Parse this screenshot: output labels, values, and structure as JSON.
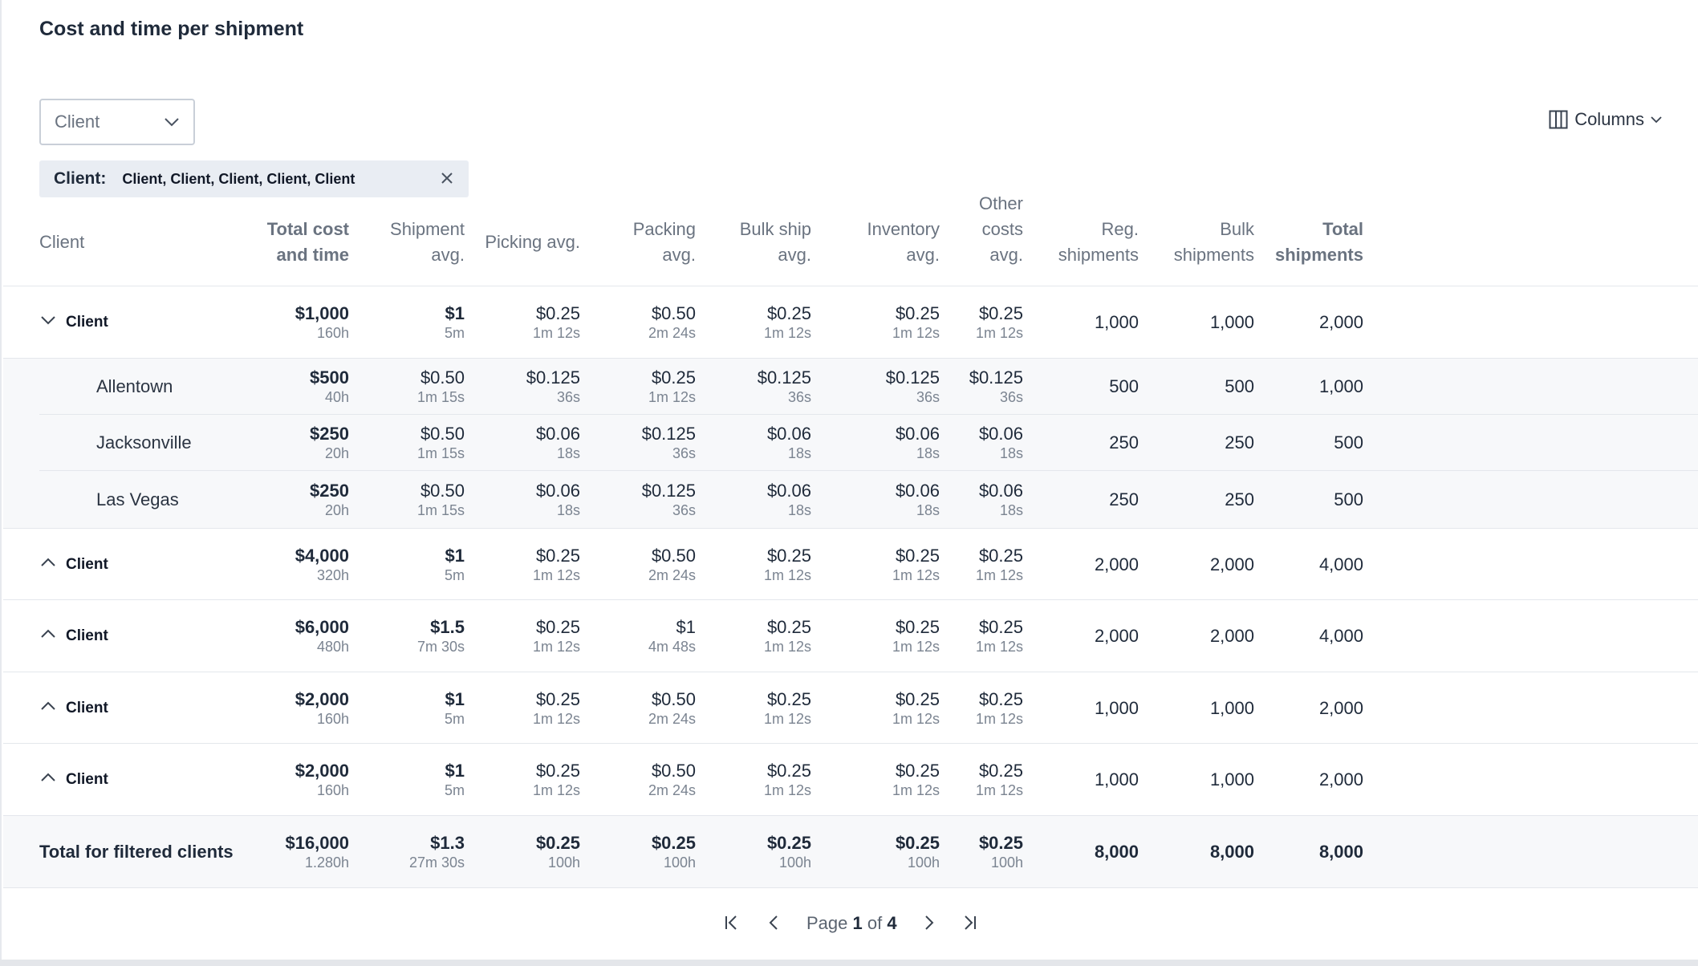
{
  "title": "Cost and time per shipment",
  "filter": {
    "select_value": "Client",
    "chip_label": "Client:",
    "chip_value": "Client, Client, Client, Client, Client"
  },
  "toolbar": {
    "columns_label": "Columns"
  },
  "icons": {
    "chevron": "chevron-down-icon",
    "columns": "columns-icon",
    "close": "close-icon"
  },
  "columns": [
    {
      "key": "client",
      "label": [
        "Client"
      ]
    },
    {
      "key": "total",
      "label": [
        "Total cost",
        "and time"
      ]
    },
    {
      "key": "ship",
      "label": [
        "Shipment",
        "avg."
      ]
    },
    {
      "key": "pick",
      "label": [
        "Picking avg."
      ]
    },
    {
      "key": "pack",
      "label": [
        "Packing",
        "avg."
      ]
    },
    {
      "key": "bulk",
      "label": [
        "Bulk ship",
        "avg."
      ]
    },
    {
      "key": "inv",
      "label": [
        "Inventory",
        "avg."
      ]
    },
    {
      "key": "other",
      "label": [
        "Other",
        "costs",
        "avg."
      ]
    },
    {
      "key": "reg",
      "label": [
        "Reg.",
        "shipments"
      ]
    },
    {
      "key": "bship",
      "label": [
        "Bulk",
        "shipments"
      ]
    },
    {
      "key": "tship",
      "label": [
        "Total",
        "shipments"
      ]
    }
  ],
  "rows": [
    {
      "type": "parent",
      "expanded": true,
      "name": "Client",
      "cells": [
        [
          "$1,000",
          "160h"
        ],
        [
          "$1",
          "5m"
        ],
        [
          "$0.25",
          "1m 12s"
        ],
        [
          "$0.50",
          "2m 24s"
        ],
        [
          "$0.25",
          "1m 12s"
        ],
        [
          "$0.25",
          "1m 12s"
        ],
        [
          "$0.25",
          "1m 12s"
        ],
        [
          "1,000"
        ],
        [
          "1,000"
        ],
        [
          "2,000"
        ]
      ]
    },
    {
      "type": "child",
      "name": "Allentown",
      "cells": [
        [
          "$500",
          "40h"
        ],
        [
          "$0.50",
          "1m 15s"
        ],
        [
          "$0.125",
          "36s"
        ],
        [
          "$0.25",
          "1m 12s"
        ],
        [
          "$0.125",
          "36s"
        ],
        [
          "$0.125",
          "36s"
        ],
        [
          "$0.125",
          "36s"
        ],
        [
          "500"
        ],
        [
          "500"
        ],
        [
          "1,000"
        ]
      ]
    },
    {
      "type": "child",
      "name": "Jacksonville",
      "cells": [
        [
          "$250",
          "20h"
        ],
        [
          "$0.50",
          "1m 15s"
        ],
        [
          "$0.06",
          "18s"
        ],
        [
          "$0.125",
          "36s"
        ],
        [
          "$0.06",
          "18s"
        ],
        [
          "$0.06",
          "18s"
        ],
        [
          "$0.06",
          "18s"
        ],
        [
          "250"
        ],
        [
          "250"
        ],
        [
          "500"
        ]
      ]
    },
    {
      "type": "child",
      "name": "Las Vegas",
      "cells": [
        [
          "$250",
          "20h"
        ],
        [
          "$0.50",
          "1m 15s"
        ],
        [
          "$0.06",
          "18s"
        ],
        [
          "$0.125",
          "36s"
        ],
        [
          "$0.06",
          "18s"
        ],
        [
          "$0.06",
          "18s"
        ],
        [
          "$0.06",
          "18s"
        ],
        [
          "250"
        ],
        [
          "250"
        ],
        [
          "500"
        ]
      ]
    },
    {
      "type": "parent",
      "expanded": false,
      "name": "Client",
      "cells": [
        [
          "$4,000",
          "320h"
        ],
        [
          "$1",
          "5m"
        ],
        [
          "$0.25",
          "1m 12s"
        ],
        [
          "$0.50",
          "2m 24s"
        ],
        [
          "$0.25",
          "1m 12s"
        ],
        [
          "$0.25",
          "1m 12s"
        ],
        [
          "$0.25",
          "1m 12s"
        ],
        [
          "2,000"
        ],
        [
          "2,000"
        ],
        [
          "4,000"
        ]
      ]
    },
    {
      "type": "parent",
      "expanded": false,
      "name": "Client",
      "cells": [
        [
          "$6,000",
          "480h"
        ],
        [
          "$1.5",
          "7m 30s"
        ],
        [
          "$0.25",
          "1m 12s"
        ],
        [
          "$1",
          "4m 48s"
        ],
        [
          "$0.25",
          "1m 12s"
        ],
        [
          "$0.25",
          "1m 12s"
        ],
        [
          "$0.25",
          "1m 12s"
        ],
        [
          "2,000"
        ],
        [
          "2,000"
        ],
        [
          "4,000"
        ]
      ]
    },
    {
      "type": "parent",
      "expanded": false,
      "name": "Client",
      "cells": [
        [
          "$2,000",
          "160h"
        ],
        [
          "$1",
          "5m"
        ],
        [
          "$0.25",
          "1m 12s"
        ],
        [
          "$0.50",
          "2m 24s"
        ],
        [
          "$0.25",
          "1m 12s"
        ],
        [
          "$0.25",
          "1m 12s"
        ],
        [
          "$0.25",
          "1m 12s"
        ],
        [
          "1,000"
        ],
        [
          "1,000"
        ],
        [
          "2,000"
        ]
      ]
    },
    {
      "type": "parent",
      "expanded": false,
      "name": "Client",
      "cells": [
        [
          "$2,000",
          "160h"
        ],
        [
          "$1",
          "5m"
        ],
        [
          "$0.25",
          "1m 12s"
        ],
        [
          "$0.50",
          "2m 24s"
        ],
        [
          "$0.25",
          "1m 12s"
        ],
        [
          "$0.25",
          "1m 12s"
        ],
        [
          "$0.25",
          "1m 12s"
        ],
        [
          "1,000"
        ],
        [
          "1,000"
        ],
        [
          "2,000"
        ]
      ]
    },
    {
      "type": "total",
      "name": "Total for filtered clients",
      "cells": [
        [
          "$16,000",
          "1.280h"
        ],
        [
          "$1.3",
          "27m 30s"
        ],
        [
          "$0.25",
          "100h"
        ],
        [
          "$0.25",
          "100h"
        ],
        [
          "$0.25",
          "100h"
        ],
        [
          "$0.25",
          "100h"
        ],
        [
          "$0.25",
          "100h"
        ],
        [
          "8,000"
        ],
        [
          "8,000"
        ],
        [
          "8,000"
        ]
      ]
    }
  ],
  "pagination": {
    "page_word": "Page",
    "current": "1",
    "of_word": "of",
    "total": "4"
  }
}
